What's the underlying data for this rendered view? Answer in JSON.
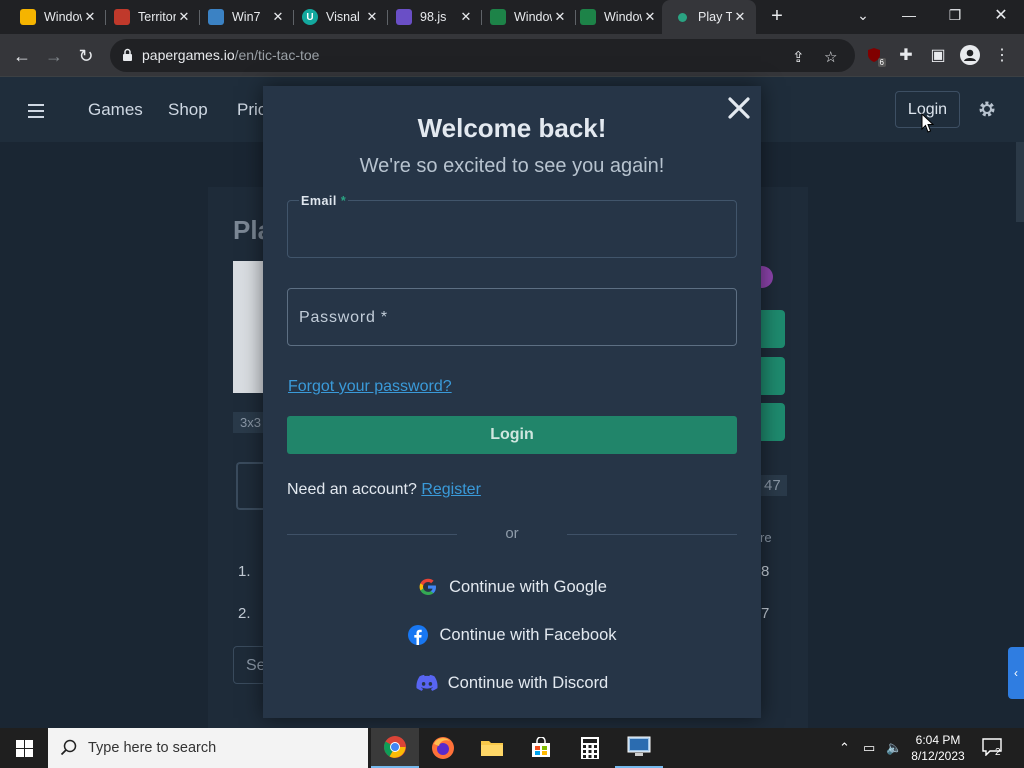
{
  "browser": {
    "tabs": [
      {
        "title": "Windows",
        "favicon": "lemon-icon",
        "color": "#f5b400"
      },
      {
        "title": "Territory",
        "favicon": "flag-icon",
        "color": "#c0392b"
      },
      {
        "title": "Win7",
        "favicon": "win7-icon",
        "color": "#3b82c4"
      },
      {
        "title": "Visnal",
        "favicon": "u-icon",
        "color": "#13a89e"
      },
      {
        "title": "98.js",
        "favicon": "98-icon",
        "color": "#6a4fc6"
      },
      {
        "title": "Windows",
        "favicon": "sheet-icon",
        "color": "#1d8348"
      },
      {
        "title": "Windows",
        "favicon": "sheet-icon",
        "color": "#1d8348"
      },
      {
        "title": "Play T",
        "favicon": "dot-icon",
        "color": "#2aa382",
        "active": true
      }
    ],
    "new_tab": "+",
    "url_host": "papergames.io",
    "url_path": "/en/tic-tac-toe",
    "ext_badge": "6"
  },
  "site": {
    "nav": [
      "Games",
      "Shop",
      "Pric"
    ],
    "login_label": "Login",
    "bg": {
      "heading": "Pla",
      "size_label": "3x3",
      "score_a": "47",
      "re": "re",
      "rank1": "1.",
      "rank2": "2.",
      "num8": "8",
      "num7": "7",
      "search": "Se"
    }
  },
  "modal": {
    "title": "Welcome back!",
    "subtitle": "We're so excited to see you again!",
    "email_label": "Email",
    "required_mark": "*",
    "password_placeholder": "Password *",
    "forgot": "Forgot your password?",
    "submit": "Login",
    "need_account": "Need an account?",
    "register": "Register",
    "or": "or",
    "google": "Continue with Google",
    "facebook": "Continue with Facebook",
    "discord": "Continue with Discord"
  },
  "taskbar": {
    "search_placeholder": "Type here to search",
    "time": "6:04 PM",
    "date": "8/12/2023",
    "notifications": "2"
  }
}
